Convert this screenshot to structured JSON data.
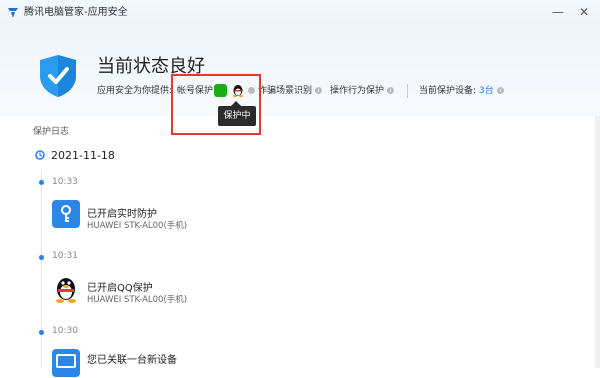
{
  "window": {
    "title": "腾讯电脑管家-应用安全",
    "minimize": "—",
    "close": "✕"
  },
  "header": {
    "status_title": "当前状态良好",
    "provides_label": "应用安全为你提供:",
    "account_protect": "帐号保护",
    "fraud_detect": "诈骗场景识别",
    "behavior_protect": "操作行为保护",
    "devices_label": "当前保护设备:",
    "devices_count": "3台",
    "tooltip": "保护中"
  },
  "log": {
    "section_label": "保护日志",
    "date": "2021-11-18",
    "entries": [
      {
        "time": "10:33",
        "title": "已开启实时防护",
        "sub": "HUAWEI STK-AL00(手机)",
        "icon": "key-icon"
      },
      {
        "time": "10:31",
        "title": "已开启QQ保护",
        "sub": "HUAWEI STK-AL00(手机)",
        "icon": "qq-icon"
      },
      {
        "time": "10:30",
        "title": "您已关联一台新设备",
        "sub": "",
        "icon": "device-icon"
      }
    ]
  },
  "colors": {
    "accent": "#2b7de9",
    "wechat": "#1aad19",
    "highlight": "#e23c32",
    "tooltip_bg": "#2b2b2b"
  }
}
